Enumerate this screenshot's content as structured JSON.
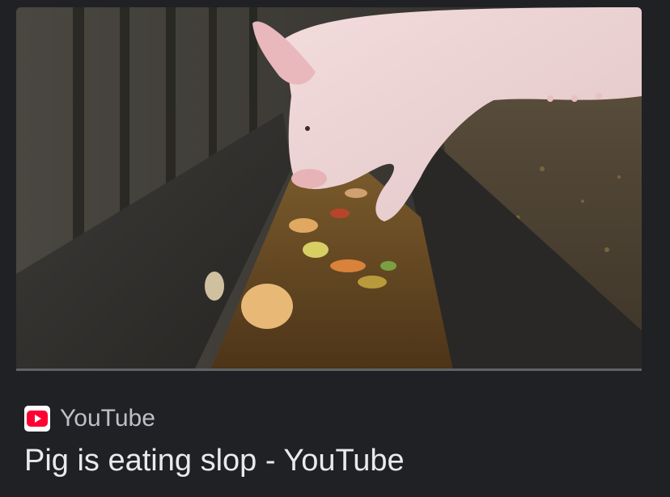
{
  "result": {
    "thumbnail_alt": "Pig eating slop from a trough",
    "source": {
      "name": "YouTube",
      "icon": "youtube-logo-icon",
      "brand_color": "#ff0033"
    },
    "title": "Pig is eating slop - YouTube"
  },
  "colors": {
    "background": "#202124",
    "title_text": "#e8eaed",
    "source_text": "#bdc1c6"
  }
}
